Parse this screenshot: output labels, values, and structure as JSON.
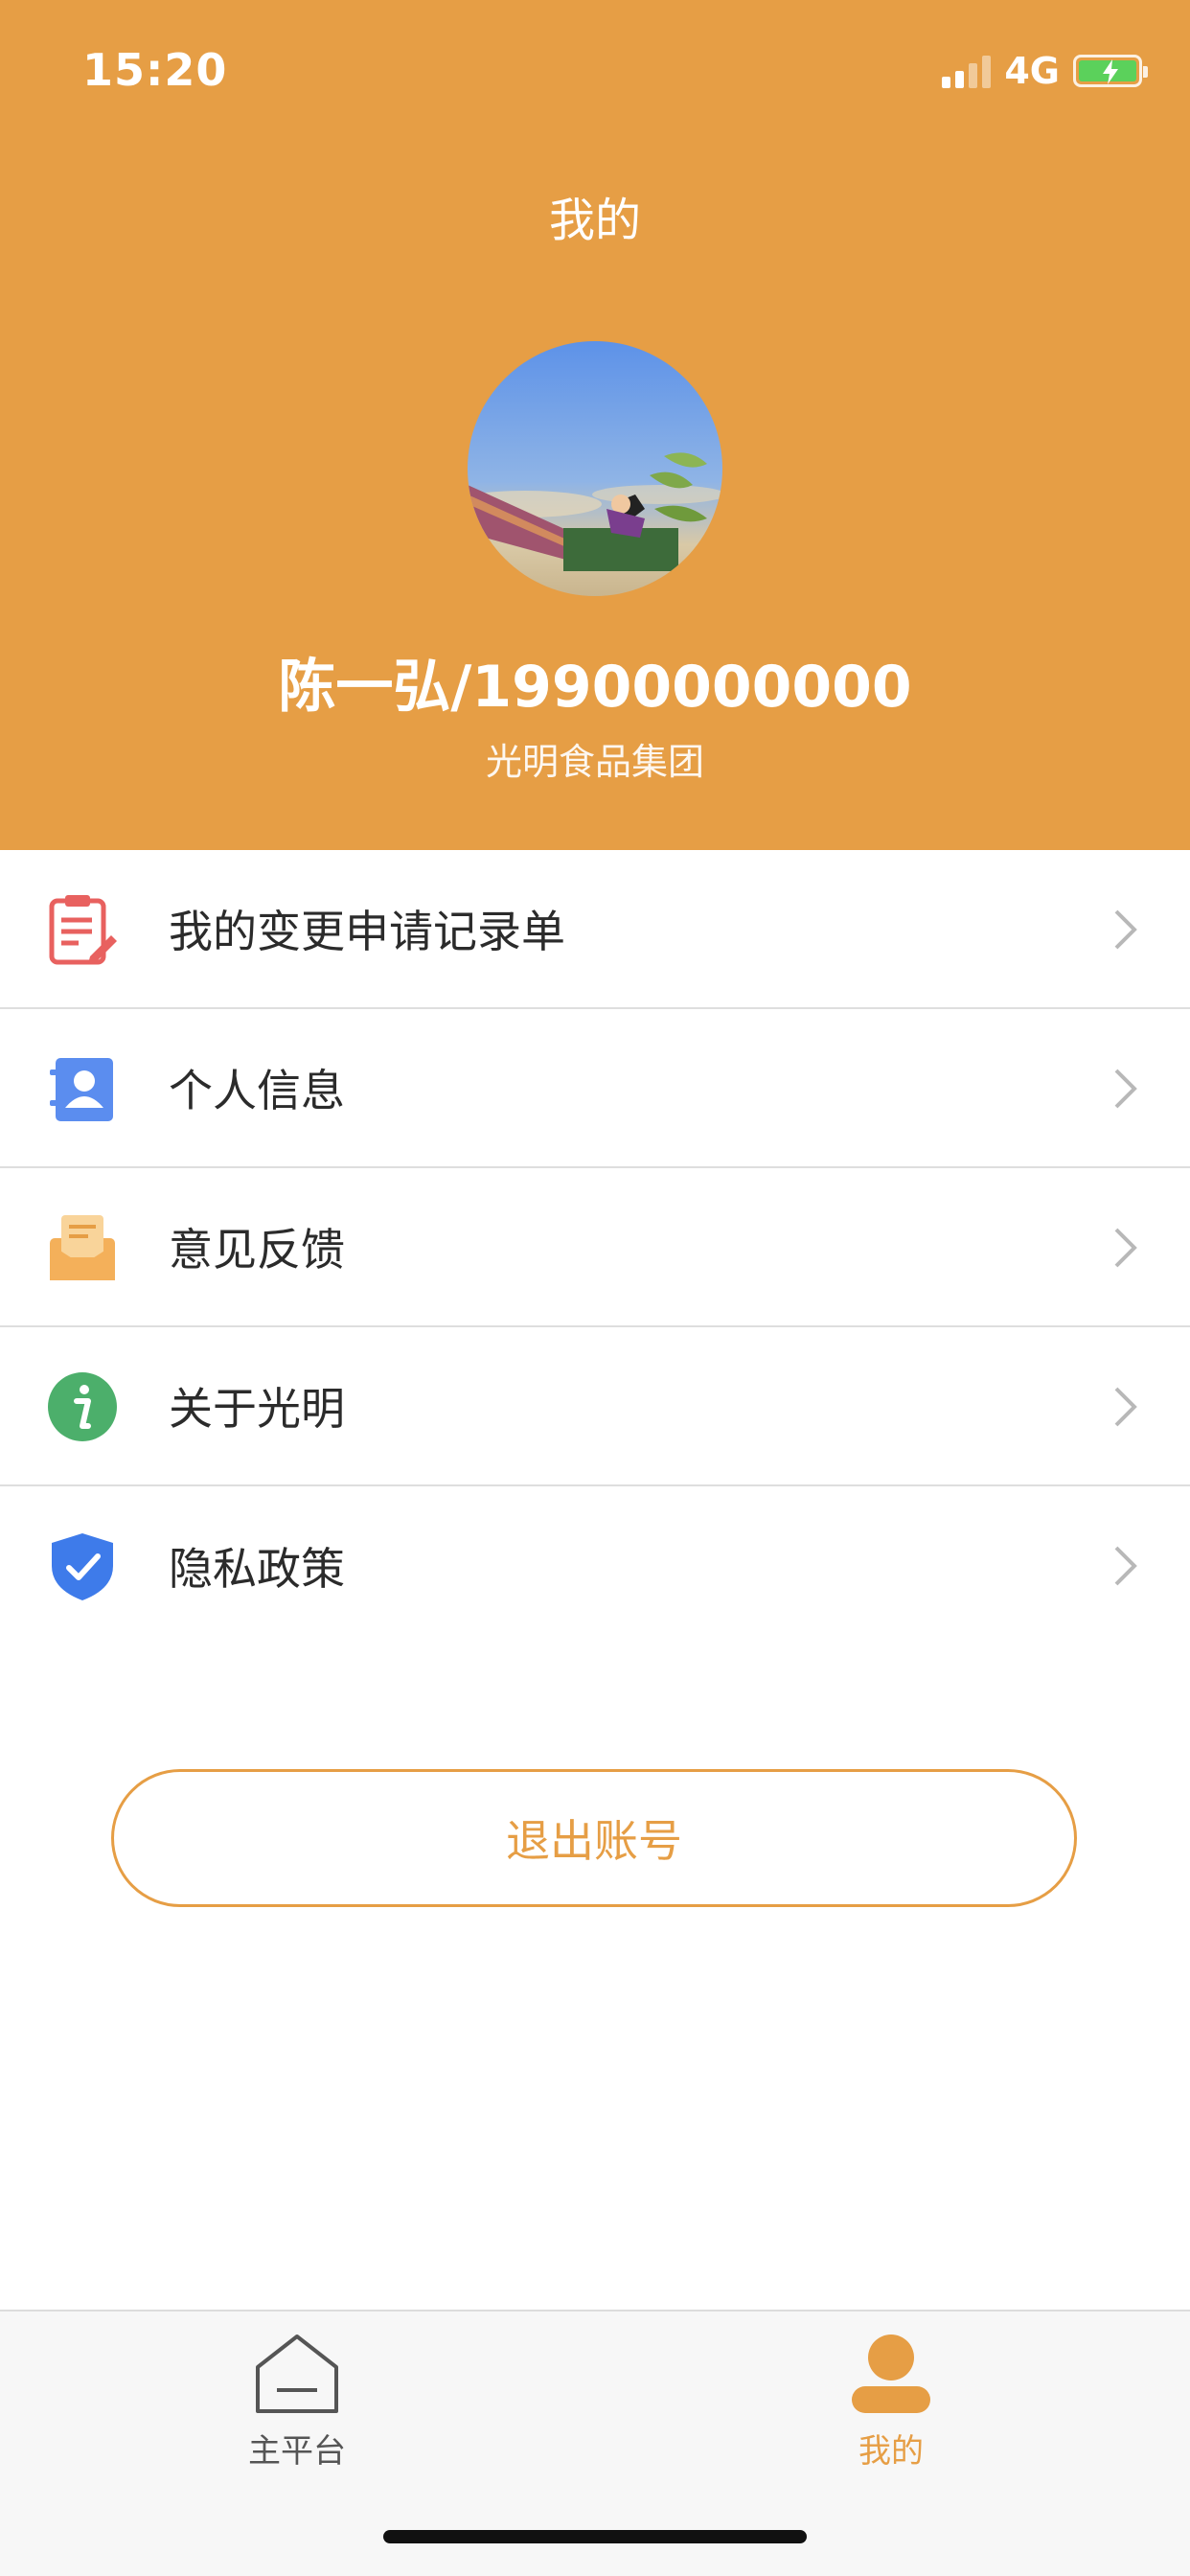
{
  "status_bar": {
    "time": "15:20",
    "network": "4G"
  },
  "header": {
    "title": "我的",
    "user_name": "陈一弘/19900000000",
    "company": "光明食品集团"
  },
  "menu": {
    "items": [
      {
        "label": "我的变更申请记录单",
        "icon": "clipboard-edit-icon"
      },
      {
        "label": "个人信息",
        "icon": "contact-card-icon"
      },
      {
        "label": "意见反馈",
        "icon": "feedback-mail-icon"
      },
      {
        "label": "关于光明",
        "icon": "info-icon"
      },
      {
        "label": "隐私政策",
        "icon": "shield-check-icon"
      }
    ]
  },
  "logout": {
    "label": "退出账号"
  },
  "tabbar": {
    "tabs": [
      {
        "label": "主平台",
        "icon": "home-icon",
        "active": false
      },
      {
        "label": "我的",
        "icon": "user-icon",
        "active": true
      }
    ]
  },
  "colors": {
    "brand": "#E69E45",
    "icon_red": "#E8615F",
    "icon_blue": "#5B8DEF",
    "icon_orange": "#F4B05A",
    "icon_green": "#4CAF6B",
    "shield_blue": "#3E7BEA"
  }
}
